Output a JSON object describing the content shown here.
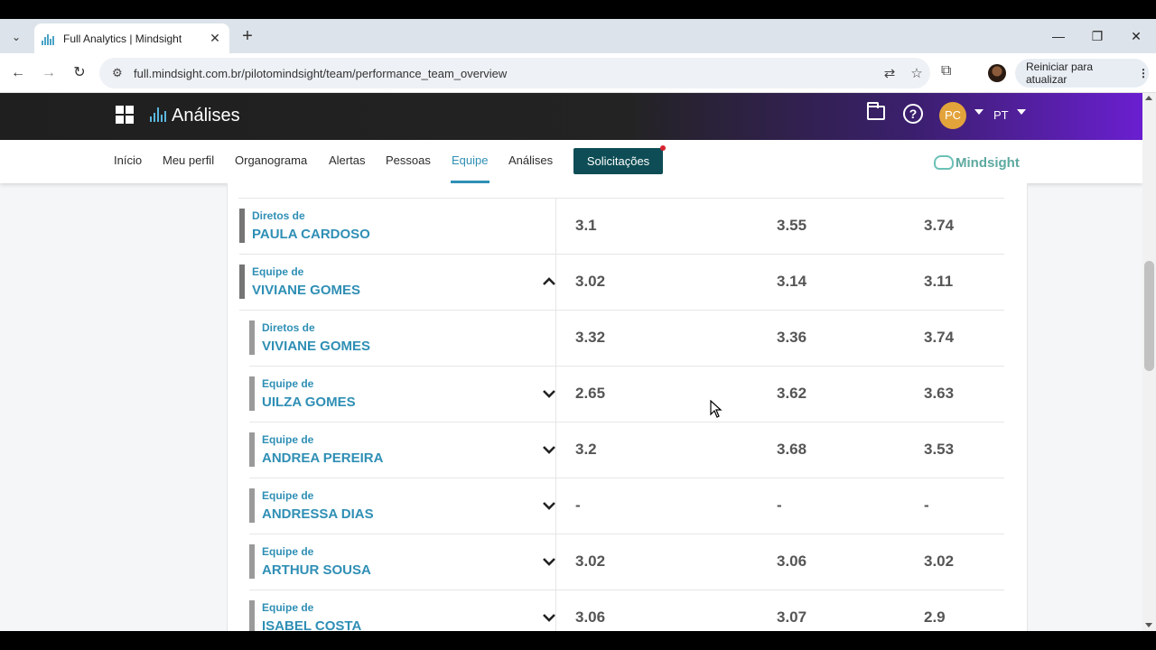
{
  "browser": {
    "tab_title": "Full Analytics | Mindsight",
    "tab_close": "✕",
    "new_tab": "+",
    "url": "full.mindsight.com.br/pilotomindsight/team/performance_team_overview",
    "update_button": "Reiniciar para atualizar",
    "window_controls": [
      "—",
      "❐",
      "✕"
    ]
  },
  "app": {
    "title": "Análises",
    "user_initials": "PC",
    "language": "PT",
    "help": "?"
  },
  "nav": {
    "items": [
      "Início",
      "Meu perfil",
      "Organograma",
      "Alertas",
      "Pessoas",
      "Equipe",
      "Análises"
    ],
    "active": "Equipe",
    "requests_button": "Solicitações",
    "brand": "Mindsight"
  },
  "rows": [
    {
      "prefix": "Diretos de",
      "name": "PAULA CARDOSO",
      "level": 0,
      "chevron": "none",
      "values": [
        "3.1",
        "3.55",
        "3.74"
      ]
    },
    {
      "prefix": "Equipe de",
      "name": "VIVIANE GOMES",
      "level": 0,
      "chevron": "up",
      "values": [
        "3.02",
        "3.14",
        "3.11"
      ]
    },
    {
      "prefix": "Diretos de",
      "name": "VIVIANE GOMES",
      "level": 1,
      "chevron": "none",
      "values": [
        "3.32",
        "3.36",
        "3.74"
      ]
    },
    {
      "prefix": "Equipe de",
      "name": "UILZA GOMES",
      "level": 1,
      "chevron": "down",
      "values": [
        "2.65",
        "3.62",
        "3.63"
      ]
    },
    {
      "prefix": "Equipe de",
      "name": "ANDREA PEREIRA",
      "level": 1,
      "chevron": "down",
      "values": [
        "3.2",
        "3.68",
        "3.53"
      ]
    },
    {
      "prefix": "Equipe de",
      "name": "ANDRESSA DIAS",
      "level": 1,
      "chevron": "down",
      "values": [
        "-",
        "-",
        "-"
      ]
    },
    {
      "prefix": "Equipe de",
      "name": "ARTHUR SOUSA",
      "level": 1,
      "chevron": "down",
      "values": [
        "3.02",
        "3.06",
        "3.02"
      ]
    },
    {
      "prefix": "Equipe de",
      "name": "ISABEL COSTA",
      "level": 1,
      "chevron": "down",
      "values": [
        "3.06",
        "3.07",
        "2.9"
      ]
    }
  ],
  "colors": {
    "accent": "#2f8fb5",
    "requests_bg": "#0e4d55",
    "notification_dot": "#d9232f",
    "avatar_bg": "#e3a33b"
  }
}
